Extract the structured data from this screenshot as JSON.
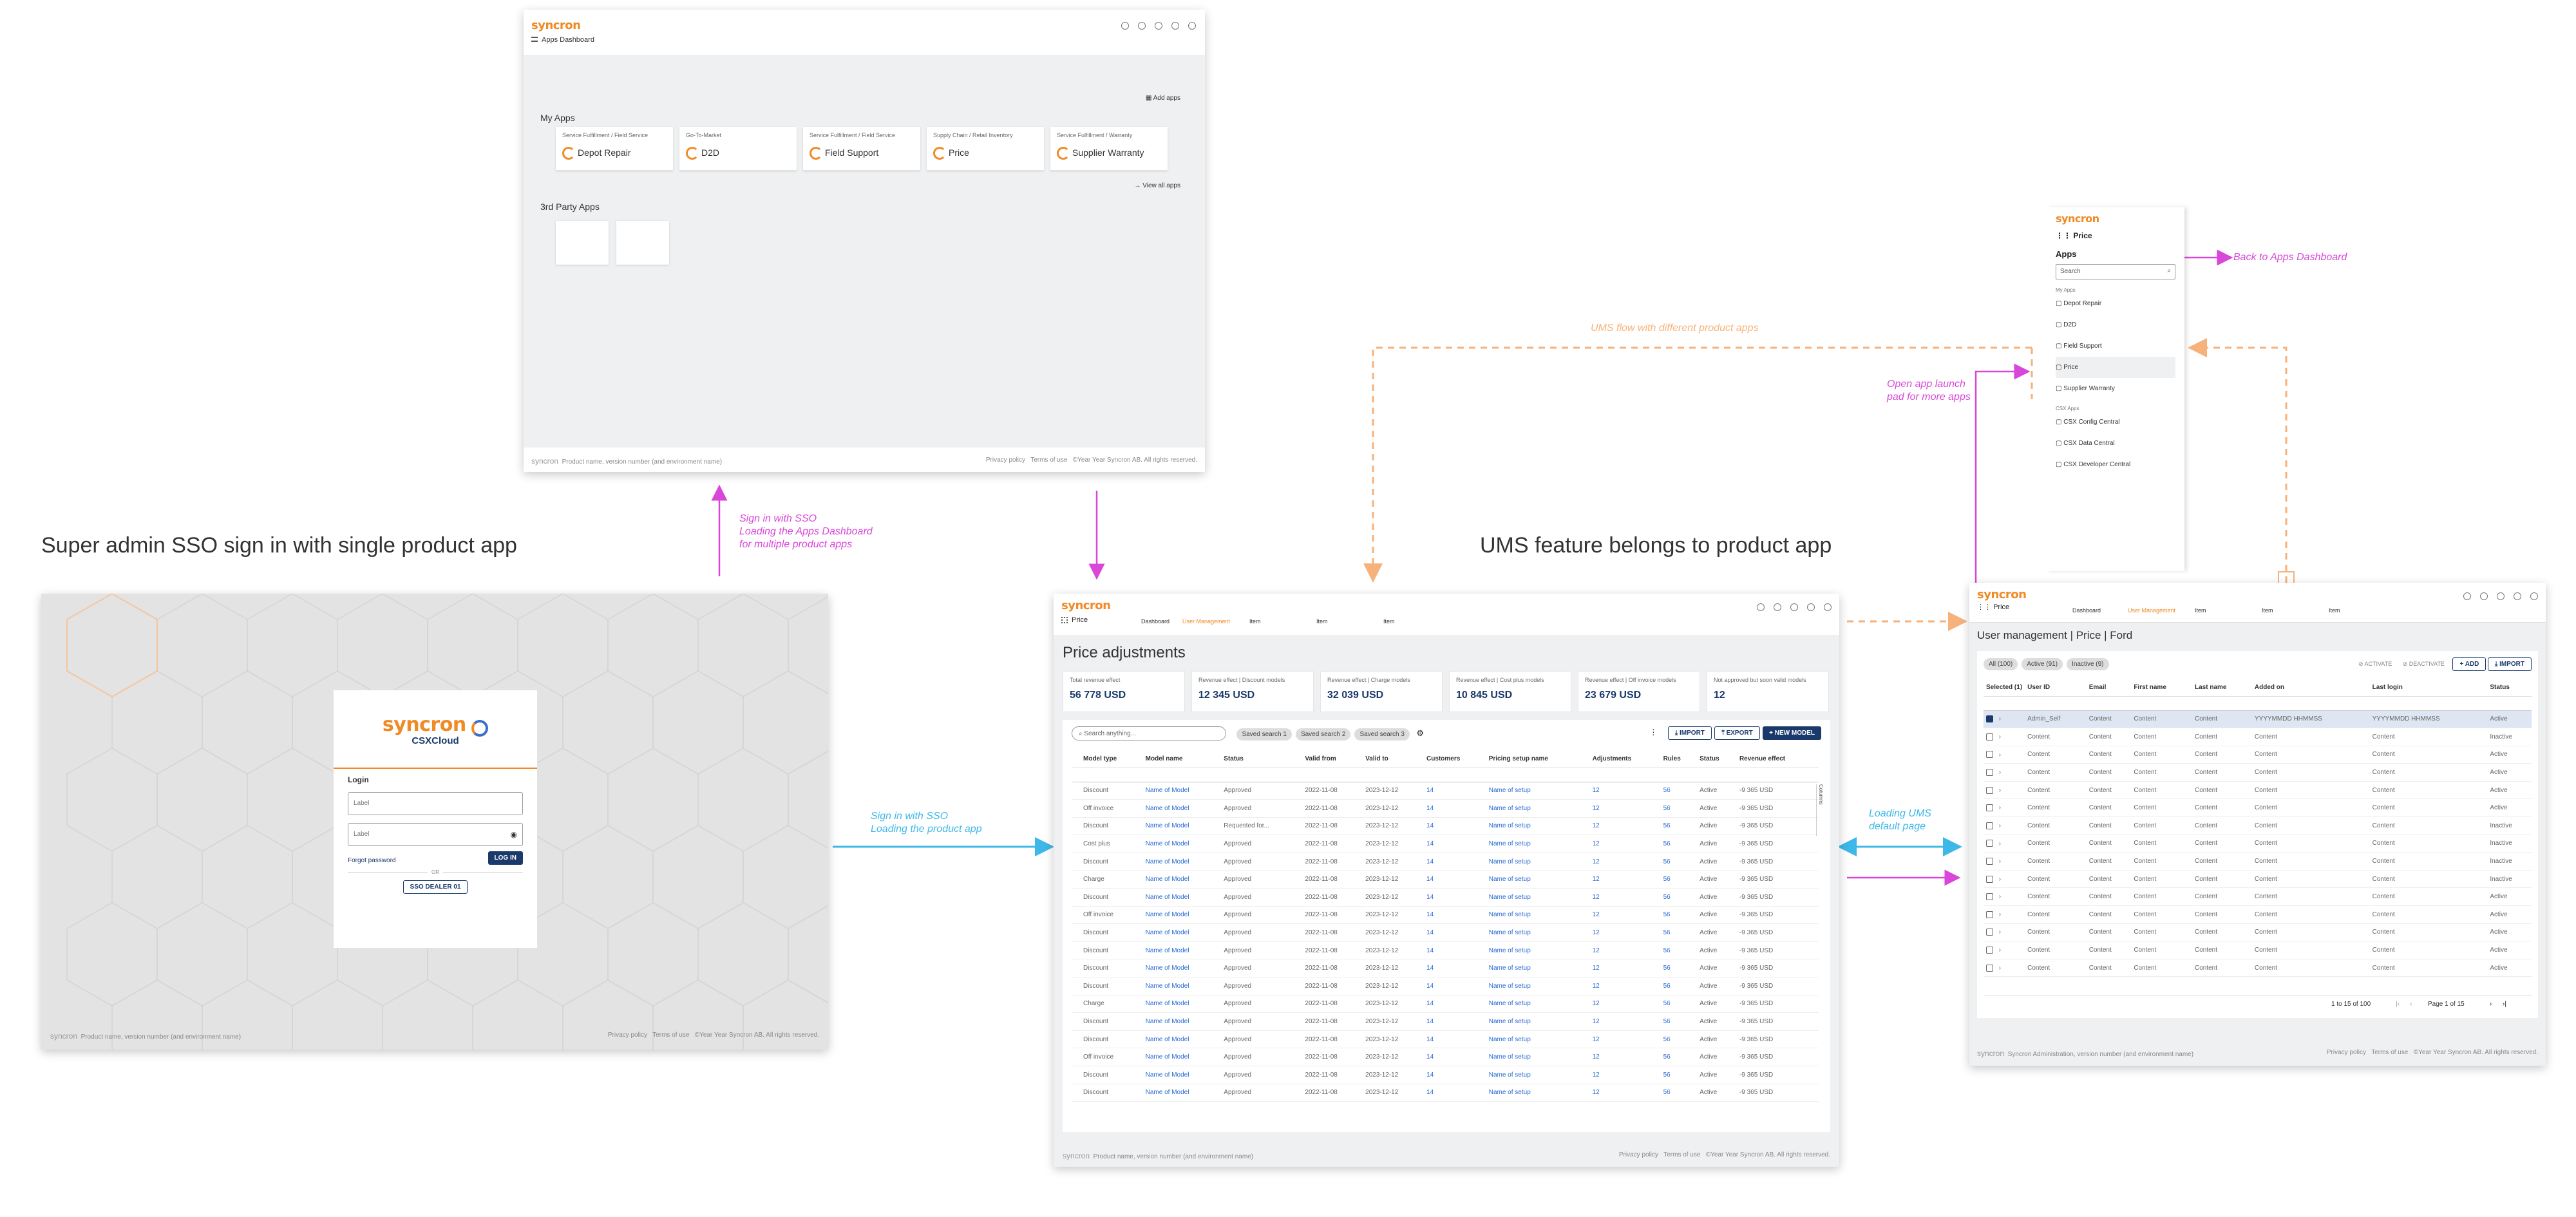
{
  "headings": {
    "left": "Super admin  SSO sign in with single product app",
    "middle": "UMS feature belongs to product  app"
  },
  "notes": {
    "sso_dashboard": "Sign in with SSO\nLoading the Apps Dashboard\nfor multiple product apps",
    "sso_product": "Sign in with SSO\nLoading the product app",
    "ums_flow": "UMS flow with different product apps",
    "open_launchpad": "Open app launch\npad for more apps",
    "back_dashboard": "Back to Apps Dashboard",
    "loading_ums": "Loading UMS\ndefault page"
  },
  "colors": {
    "accent_orange": "#f08a24",
    "pink": "#d946d9",
    "blue": "#3db8e8",
    "navy": "#1a3a6b",
    "link": "#2a6bd1"
  },
  "dashboard": {
    "logo": "syncron",
    "breadcrumb": "Apps Dashboard",
    "my_apps_title": "My Apps",
    "add_apps": "Add apps",
    "view_all": "View all apps",
    "third_party_title": "3rd Party Apps",
    "apps": [
      {
        "category": "Service Fulfillment / Field Service",
        "name": "Depot Repair"
      },
      {
        "category": "Go-To-Market",
        "name": "D2D"
      },
      {
        "category": "Service Fulfillment / Field Service",
        "name": "Field Support"
      },
      {
        "category": "Supply Chain / Retail Inventory",
        "name": "Price"
      },
      {
        "category": "Service Fulfillment / Warranty",
        "name": "Supplier Warranty"
      }
    ],
    "footer": {
      "brand": "syncron",
      "product": "Product name, version number (and environment name)",
      "privacy": "Privacy policy",
      "terms": "Terms of use",
      "copyright": "©Year Year Syncron AB. All rights reserved."
    }
  },
  "login": {
    "logo": "syncron",
    "sub_logo": "CSXCloud",
    "title": "Login",
    "field1_placeholder": "Label",
    "field2_placeholder": "Label",
    "forgot": "Forgot password",
    "login_button": "LOG IN",
    "or": "OR",
    "sso_button": "SSO DEALER 01",
    "footer": {
      "brand": "syncron",
      "product": "Product name, version number (and environment name)",
      "privacy": "Privacy policy",
      "terms": "Terms of use",
      "copyright": "©Year Year Syncron AB. All rights reserved."
    }
  },
  "price": {
    "logo": "syncron",
    "app_name": "Price",
    "nav": [
      "Dashboard",
      "User Management",
      "Item",
      "Item",
      "Item"
    ],
    "page_title": "Price adjustments",
    "kpis": [
      {
        "label": "Total revenue effect",
        "value": "56 778 USD"
      },
      {
        "label": "Revenue effect | Discount models",
        "value": "12 345 USD"
      },
      {
        "label": "Revenue effect | Charge models",
        "value": "32 039 USD"
      },
      {
        "label": "Revenue effect | Cost plus models",
        "value": "10 845 USD"
      },
      {
        "label": "Revenue effect | Off invoice models",
        "value": "23 679 USD"
      },
      {
        "label": "Not approved but soon valid models",
        "value": "12"
      }
    ],
    "search_placeholder": "Search anything...",
    "saved_searches": [
      "Saved search 1",
      "Saved search 2",
      "Saved search 3"
    ],
    "import": "IMPORT",
    "export": "EXPORT",
    "new_model": "NEW MODEL",
    "columns_label": "Columns",
    "headers": [
      "Model type",
      "Model name",
      "Status",
      "Valid from",
      "Valid to",
      "Customers",
      "Pricing setup name",
      "Adjustments",
      "Rules",
      "Status",
      "Revenue effect"
    ],
    "rows": [
      [
        "Discount",
        "Name of Model",
        "Approved",
        "2022-11-08",
        "2023-12-12",
        "14",
        "Name of setup",
        "12",
        "56",
        "Active",
        "-9 365 USD"
      ],
      [
        "Off invoice",
        "Name of Model",
        "Approved",
        "2022-11-08",
        "2023-12-12",
        "14",
        "Name of setup",
        "12",
        "56",
        "Active",
        "-9 365 USD"
      ],
      [
        "Discount",
        "Name of Model",
        "Requested for...",
        "2022-11-08",
        "2023-12-12",
        "14",
        "Name of setup",
        "12",
        "56",
        "Active",
        "-9 365 USD"
      ],
      [
        "Cost plus",
        "Name of Model",
        "Approved",
        "2022-11-08",
        "2023-12-12",
        "14",
        "Name of setup",
        "12",
        "56",
        "Active",
        "-9 365 USD"
      ],
      [
        "Discount",
        "Name of Model",
        "Approved",
        "2022-11-08",
        "2023-12-12",
        "14",
        "Name of setup",
        "12",
        "56",
        "Active",
        "-9 365 USD"
      ],
      [
        "Charge",
        "Name of Model",
        "Approved",
        "2022-11-08",
        "2023-12-12",
        "14",
        "Name of setup",
        "12",
        "56",
        "Active",
        "-9 365 USD"
      ],
      [
        "Discount",
        "Name of Model",
        "Approved",
        "2022-11-08",
        "2023-12-12",
        "14",
        "Name of setup",
        "12",
        "56",
        "Active",
        "-9 365 USD"
      ],
      [
        "Off invoice",
        "Name of Model",
        "Approved",
        "2022-11-08",
        "2023-12-12",
        "14",
        "Name of setup",
        "12",
        "56",
        "Active",
        "-9 365 USD"
      ],
      [
        "Discount",
        "Name of Model",
        "Approved",
        "2022-11-08",
        "2023-12-12",
        "14",
        "Name of setup",
        "12",
        "56",
        "Active",
        "-9 365 USD"
      ],
      [
        "Discount",
        "Name of Model",
        "Approved",
        "2022-11-08",
        "2023-12-12",
        "14",
        "Name of setup",
        "12",
        "56",
        "Active",
        "-9 365 USD"
      ],
      [
        "Discount",
        "Name of Model",
        "Approved",
        "2022-11-08",
        "2023-12-12",
        "14",
        "Name of setup",
        "12",
        "56",
        "Active",
        "-9 365 USD"
      ],
      [
        "Discount",
        "Name of Model",
        "Approved",
        "2022-11-08",
        "2023-12-12",
        "14",
        "Name of setup",
        "12",
        "56",
        "Active",
        "-9 365 USD"
      ],
      [
        "Charge",
        "Name of Model",
        "Approved",
        "2022-11-08",
        "2023-12-12",
        "14",
        "Name of setup",
        "12",
        "56",
        "Active",
        "-9 365 USD"
      ],
      [
        "Discount",
        "Name of Model",
        "Approved",
        "2022-11-08",
        "2023-12-12",
        "14",
        "Name of setup",
        "12",
        "56",
        "Active",
        "-9 365 USD"
      ],
      [
        "Discount",
        "Name of Model",
        "Approved",
        "2022-11-08",
        "2023-12-12",
        "14",
        "Name of setup",
        "12",
        "56",
        "Active",
        "-9 365 USD"
      ],
      [
        "Off invoice",
        "Name of Model",
        "Approved",
        "2022-11-08",
        "2023-12-12",
        "14",
        "Name of setup",
        "12",
        "56",
        "Active",
        "-9 365 USD"
      ],
      [
        "Discount",
        "Name of Model",
        "Approved",
        "2022-11-08",
        "2023-12-12",
        "14",
        "Name of setup",
        "12",
        "56",
        "Active",
        "-9 365 USD"
      ],
      [
        "Discount",
        "Name of Model",
        "Approved",
        "2022-11-08",
        "2023-12-12",
        "14",
        "Name of setup",
        "12",
        "56",
        "Active",
        "-9 365 USD"
      ]
    ],
    "footer": {
      "brand": "syncron",
      "product": "Product name, version number (and environment name)",
      "privacy": "Privacy policy",
      "terms": "Terms of use",
      "copyright": "©Year Year Syncron AB. All rights reserved."
    }
  },
  "launchpad": {
    "logo": "syncron",
    "app_name": "Price",
    "title": "Apps",
    "search_placeholder": "Search",
    "group1": "My Apps",
    "apps": [
      "Depot Repair",
      "D2D",
      "Field Support",
      "Price",
      "Supplier Warranty"
    ],
    "group2": "CSX Apps",
    "csx_apps": [
      "CSX Config Central",
      "CSX Data Central",
      "CSX Developer Central"
    ]
  },
  "ums": {
    "logo": "syncron",
    "app_name": "Price",
    "nav": [
      "Dashboard",
      "User Management",
      "Item",
      "Item",
      "Item"
    ],
    "page_title": "User management | Price | Ford",
    "tabs": [
      "All (100)",
      "Active (91)",
      "Inactive (9)"
    ],
    "activate": "ACTIVATE",
    "deactivate": "DEACTIVATE",
    "add": "ADD",
    "import": "IMPORT",
    "headers": [
      "Selected (1)",
      "User ID",
      "Email",
      "First name",
      "Last name",
      "Added on",
      "Last login",
      "Status"
    ],
    "rows": [
      {
        "id": "Admin_Self",
        "status": "Active",
        "date1": "YYYYMMDD HHMMSS",
        "date2": "YYYYMMDD HHMMSS",
        "selected": true
      },
      {
        "id": "Content",
        "status": "Inactive",
        "date1": "Content",
        "date2": "Content",
        "selected": false
      },
      {
        "id": "Content",
        "status": "Active",
        "date1": "Content",
        "date2": "Content",
        "selected": false
      },
      {
        "id": "Content",
        "status": "Active",
        "date1": "Content",
        "date2": "Content",
        "selected": false
      },
      {
        "id": "Content",
        "status": "Active",
        "date1": "Content",
        "date2": "Content",
        "selected": false
      },
      {
        "id": "Content",
        "status": "Active",
        "date1": "Content",
        "date2": "Content",
        "selected": false
      },
      {
        "id": "Content",
        "status": "Inactive",
        "date1": "Content",
        "date2": "Content",
        "selected": false
      },
      {
        "id": "Content",
        "status": "Inactive",
        "date1": "Content",
        "date2": "Content",
        "selected": false
      },
      {
        "id": "Content",
        "status": "Inactive",
        "date1": "Content",
        "date2": "Content",
        "selected": false
      },
      {
        "id": "Content",
        "status": "Inactive",
        "date1": "Content",
        "date2": "Content",
        "selected": false
      },
      {
        "id": "Content",
        "status": "Active",
        "date1": "Content",
        "date2": "Content",
        "selected": false
      },
      {
        "id": "Content",
        "status": "Active",
        "date1": "Content",
        "date2": "Content",
        "selected": false
      },
      {
        "id": "Content",
        "status": "Active",
        "date1": "Content",
        "date2": "Content",
        "selected": false
      },
      {
        "id": "Content",
        "status": "Active",
        "date1": "Content",
        "date2": "Content",
        "selected": false
      },
      {
        "id": "Content",
        "status": "Active",
        "date1": "Content",
        "date2": "Content",
        "selected": false
      }
    ],
    "pagination": "1 to 15 of 100",
    "page_of": "Page 1 of 15",
    "footer": {
      "brand": "syncron",
      "product": "Syncron Administration, version number (and environment name)",
      "privacy": "Privacy policy",
      "terms": "Terms of use",
      "copyright": "©Year Year Syncron AB. All rights reserved."
    }
  }
}
